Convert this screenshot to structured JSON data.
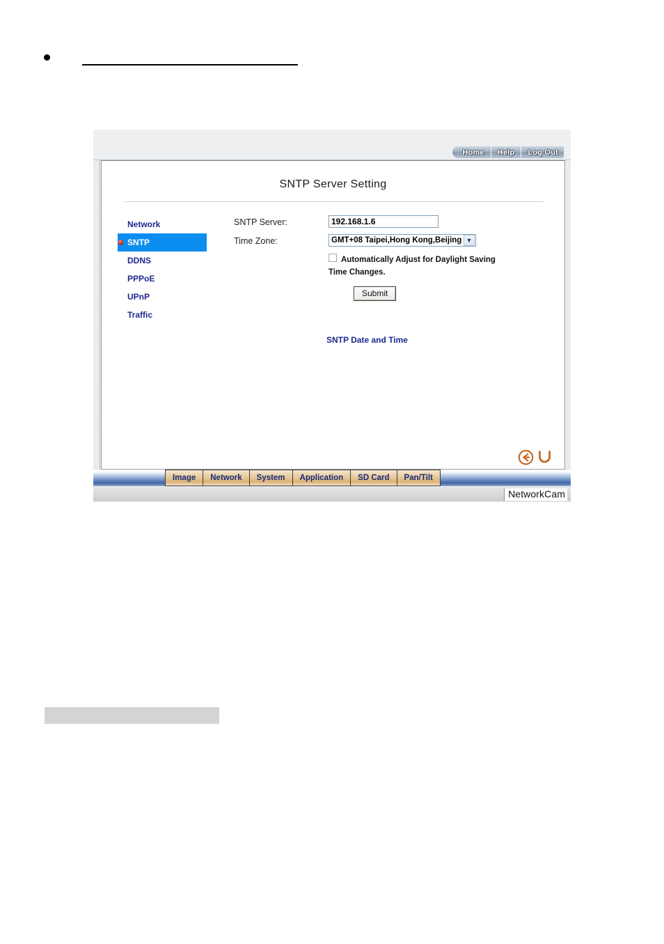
{
  "document": {
    "bullet_heading": "",
    "gray_block_text": ""
  },
  "window": {
    "topnav": [
      {
        "label": "Home",
        "name": "home"
      },
      {
        "label": "Help",
        "name": "help"
      },
      {
        "label": "Log Out",
        "name": "log-out"
      }
    ],
    "page_title": "SNTP Server Setting",
    "sidebar": {
      "items": [
        {
          "label": "Network",
          "active": false
        },
        {
          "label": "SNTP",
          "active": true
        },
        {
          "label": "DDNS",
          "active": false
        },
        {
          "label": "PPPoE",
          "active": false
        },
        {
          "label": "UPnP",
          "active": false
        },
        {
          "label": "Traffic",
          "active": false
        }
      ]
    },
    "form": {
      "sntp_server_label": "SNTP Server:",
      "sntp_server_value": "192.168.1.6",
      "time_zone_label": "Time Zone:",
      "time_zone_value": "GMT+08 Taipei,Hong Kong,Beijing",
      "time_zone_arrow": "▼",
      "dst_label": "Automatically Adjust for Daylight Saving Time Changes.",
      "dst_checked": false,
      "submit_label": "Submit"
    },
    "status": {
      "sntp_datetime_label": "SNTP Date and Time"
    },
    "nav_icons": [
      {
        "name": "back-icon",
        "glyph": "back-circle-arrow"
      },
      {
        "name": "refresh-icon",
        "glyph": "refresh-arrow"
      }
    ],
    "tabs": [
      {
        "label": "Image"
      },
      {
        "label": "Network"
      },
      {
        "label": "System"
      },
      {
        "label": "Application"
      },
      {
        "label": "SD Card"
      },
      {
        "label": "Pan/Tilt"
      }
    ],
    "brand": "NetworkCam",
    "colors": {
      "accent_blue": "#0b8ef0",
      "menu_text": "#1c2a8c",
      "tab_gold": "#e7c99c",
      "tab_text": "#172a7a",
      "nav_icon_orange": "#c8651c",
      "status_dot_red": "#d52a17"
    }
  }
}
